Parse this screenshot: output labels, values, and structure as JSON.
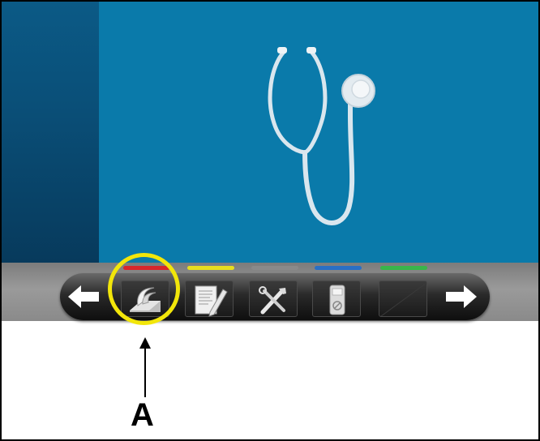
{
  "screen": {
    "illustration_icon": "stethoscope-icon"
  },
  "toolbar": {
    "back_icon": "arrow-left-icon",
    "next_icon": "arrow-right-icon",
    "buttons": [
      {
        "icon": "bed-icon",
        "indicator_color": "#d8262b"
      },
      {
        "icon": "document-pencil-icon",
        "indicator_color": "#e7de1e"
      },
      {
        "icon": "tools-icon",
        "indicator_color": "#8a8a8a"
      },
      {
        "icon": "device-remote-icon",
        "indicator_color": "#2a6fc4"
      },
      {
        "icon": "blank-icon",
        "indicator_color": "#39b54a"
      }
    ]
  },
  "annotation": {
    "label": "A",
    "highlight_color": "#f2e60a"
  }
}
